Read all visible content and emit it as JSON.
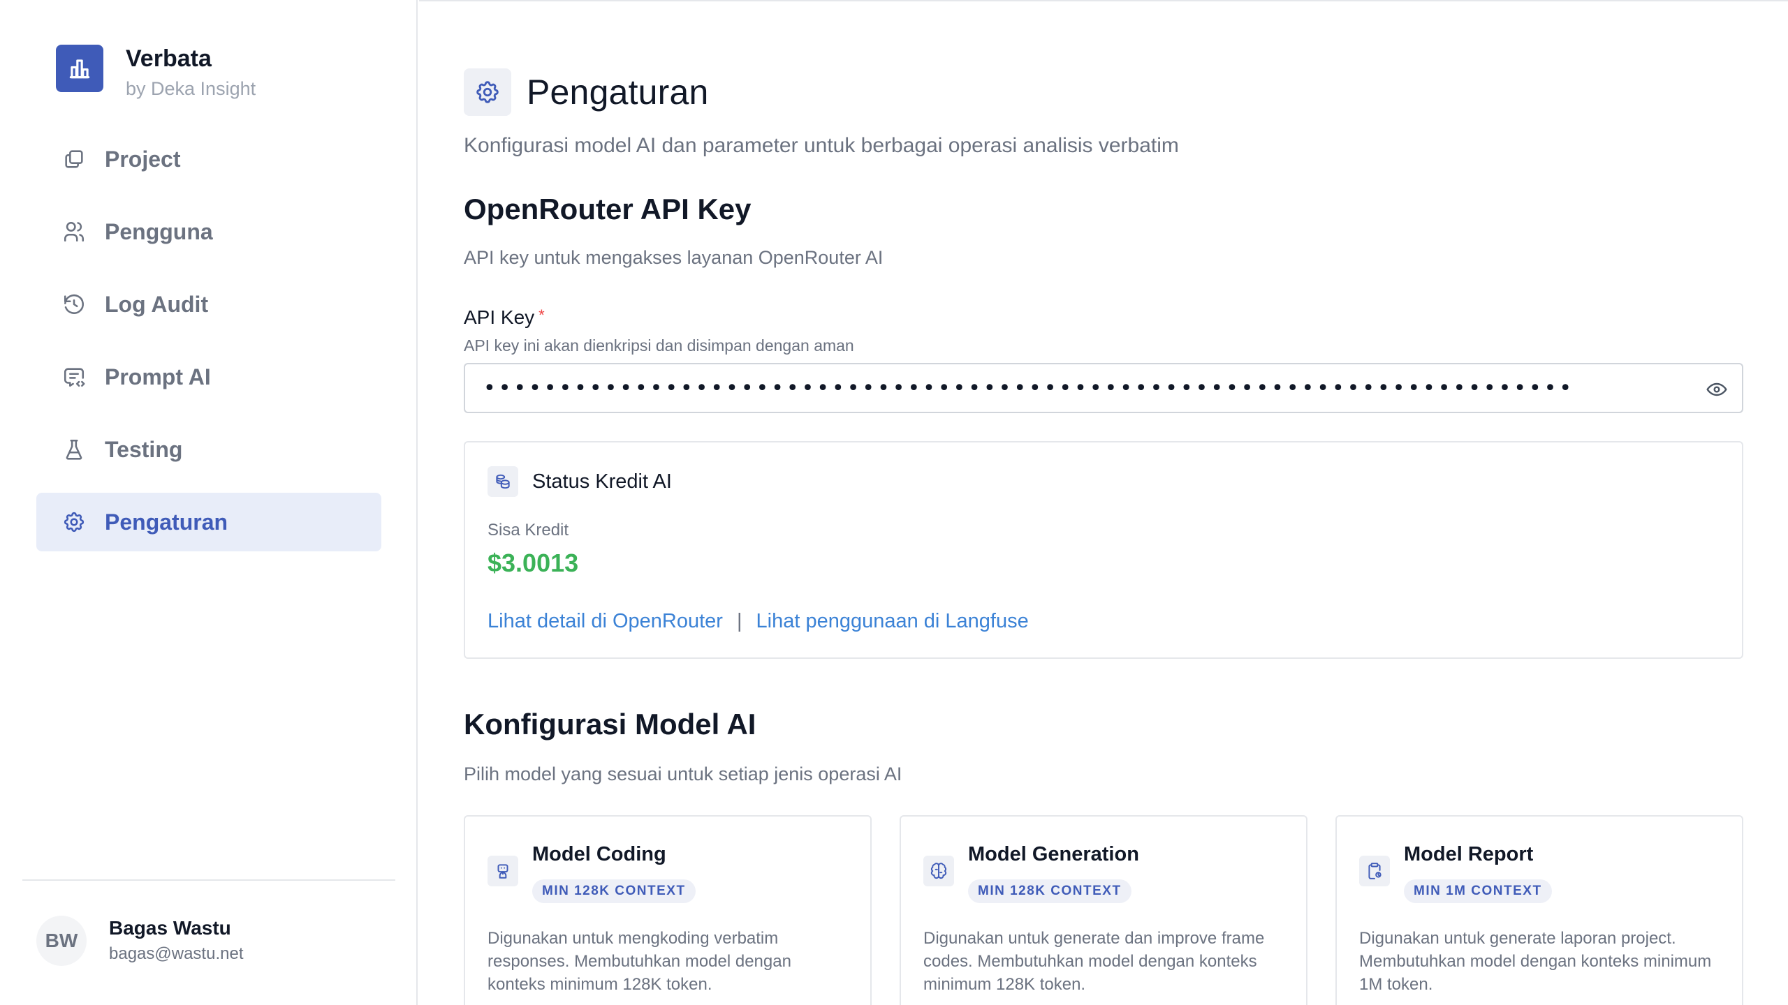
{
  "brand": {
    "name": "Verbata",
    "sub": "by Deka Insight",
    "logo_icon": "bar-chart-icon",
    "accent": "#3f5bb8"
  },
  "nav": {
    "items": [
      {
        "label": "Project",
        "icon": "folders-icon",
        "active": false
      },
      {
        "label": "Pengguna",
        "icon": "users-icon",
        "active": false
      },
      {
        "label": "Log Audit",
        "icon": "history-icon",
        "active": false
      },
      {
        "label": "Prompt AI",
        "icon": "message-code-icon",
        "active": false
      },
      {
        "label": "Testing",
        "icon": "flask-icon",
        "active": false
      },
      {
        "label": "Pengaturan",
        "icon": "gear-icon",
        "active": true
      }
    ]
  },
  "user": {
    "initials": "BW",
    "name": "Bagas Wastu",
    "email": "bagas@wastu.net"
  },
  "page": {
    "title": "Pengaturan",
    "subtitle": "Konfigurasi model AI dan parameter untuk berbagai operasi analisis verbatim"
  },
  "api_section": {
    "title": "OpenRouter API Key",
    "subtitle": "API key untuk mengakses layanan OpenRouter AI",
    "field_label": "API Key",
    "required_mark": "*",
    "field_help": "API key ini akan dienkripsi dan disimpan dengan aman",
    "masked_value": "••••••••••••••••••••••••••••••••••••••••••••••••••••••••••••••••••••••••"
  },
  "credit": {
    "title": "Status Kredit AI",
    "label": "Sisa Kredit",
    "value": "$3.0013",
    "value_color": "#3bb257",
    "link_openrouter": "Lihat detail di OpenRouter",
    "separator": "|",
    "link_langfuse": "Lihat penggunaan di Langfuse"
  },
  "models_section": {
    "title": "Konfigurasi Model AI",
    "subtitle": "Pilih model yang sesuai untuk setiap jenis operasi AI",
    "cards": [
      {
        "title": "Model Coding",
        "badge": "MIN 128K CONTEXT",
        "icon": "robot-icon",
        "description": "Digunakan untuk mengkoding verbatim responses. Membutuhkan model dengan konteks minimum 128K token."
      },
      {
        "title": "Model Generation",
        "badge": "MIN 128K CONTEXT",
        "icon": "brain-icon",
        "description": "Digunakan untuk generate dan improve frame codes. Membutuhkan model dengan konteks minimum 128K token."
      },
      {
        "title": "Model Report",
        "badge": "MIN 1M CONTEXT",
        "icon": "clipboard-icon",
        "description": "Digunakan untuk generate laporan project. Membutuhkan model dengan konteks minimum 1M token."
      }
    ]
  }
}
